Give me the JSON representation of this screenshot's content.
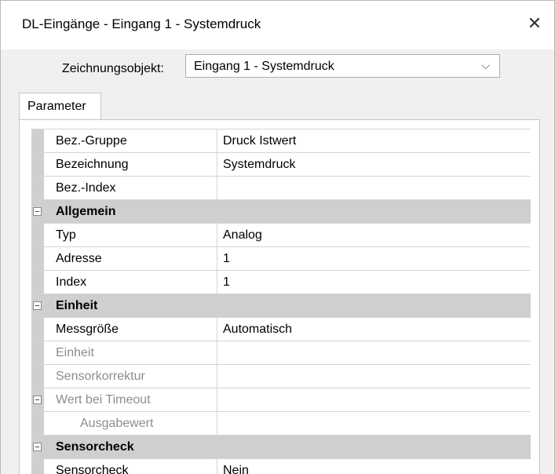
{
  "window": {
    "title": "DL-Eingänge - Eingang 1 - Systemdruck",
    "close_glyph": "✕"
  },
  "drawing_object": {
    "label": "Zeichnungsobjekt:",
    "value": "Eingang 1 - Systemdruck",
    "chevron": "⌵"
  },
  "tabs": [
    {
      "label": "Parameter",
      "selected": true
    }
  ],
  "properties": {
    "rows": {
      "bez_gruppe": {
        "name": "Bez.-Gruppe",
        "value": "Druck Istwert"
      },
      "bezeichnung": {
        "name": "Bezeichnung",
        "value": "Systemdruck"
      },
      "bez_index": {
        "name": "Bez.-Index",
        "value": ""
      },
      "allgemein": {
        "name": "Allgemein"
      },
      "typ": {
        "name": "Typ",
        "value": "Analog"
      },
      "adresse": {
        "name": "Adresse",
        "value": "1"
      },
      "index": {
        "name": "Index",
        "value": "1"
      },
      "einheit_cat": {
        "name": "Einheit"
      },
      "messgroesse": {
        "name": "Messgröße",
        "value": "Automatisch"
      },
      "einheit": {
        "name": "Einheit",
        "value": ""
      },
      "sensorkorrektur": {
        "name": "Sensorkorrektur",
        "value": ""
      },
      "wert_bei_timeout": {
        "name": "Wert bei Timeout",
        "value": ""
      },
      "ausgabewert": {
        "name": "Ausgabewert",
        "value": ""
      },
      "sensorcheck_cat": {
        "name": "Sensorcheck"
      },
      "sensorcheck": {
        "name": "Sensorcheck",
        "value": "Nein"
      }
    }
  },
  "colors": {
    "category_background": "#cfcfcf",
    "disabled_text": "#8d8d8d",
    "grid_line": "#d4d4d4"
  }
}
